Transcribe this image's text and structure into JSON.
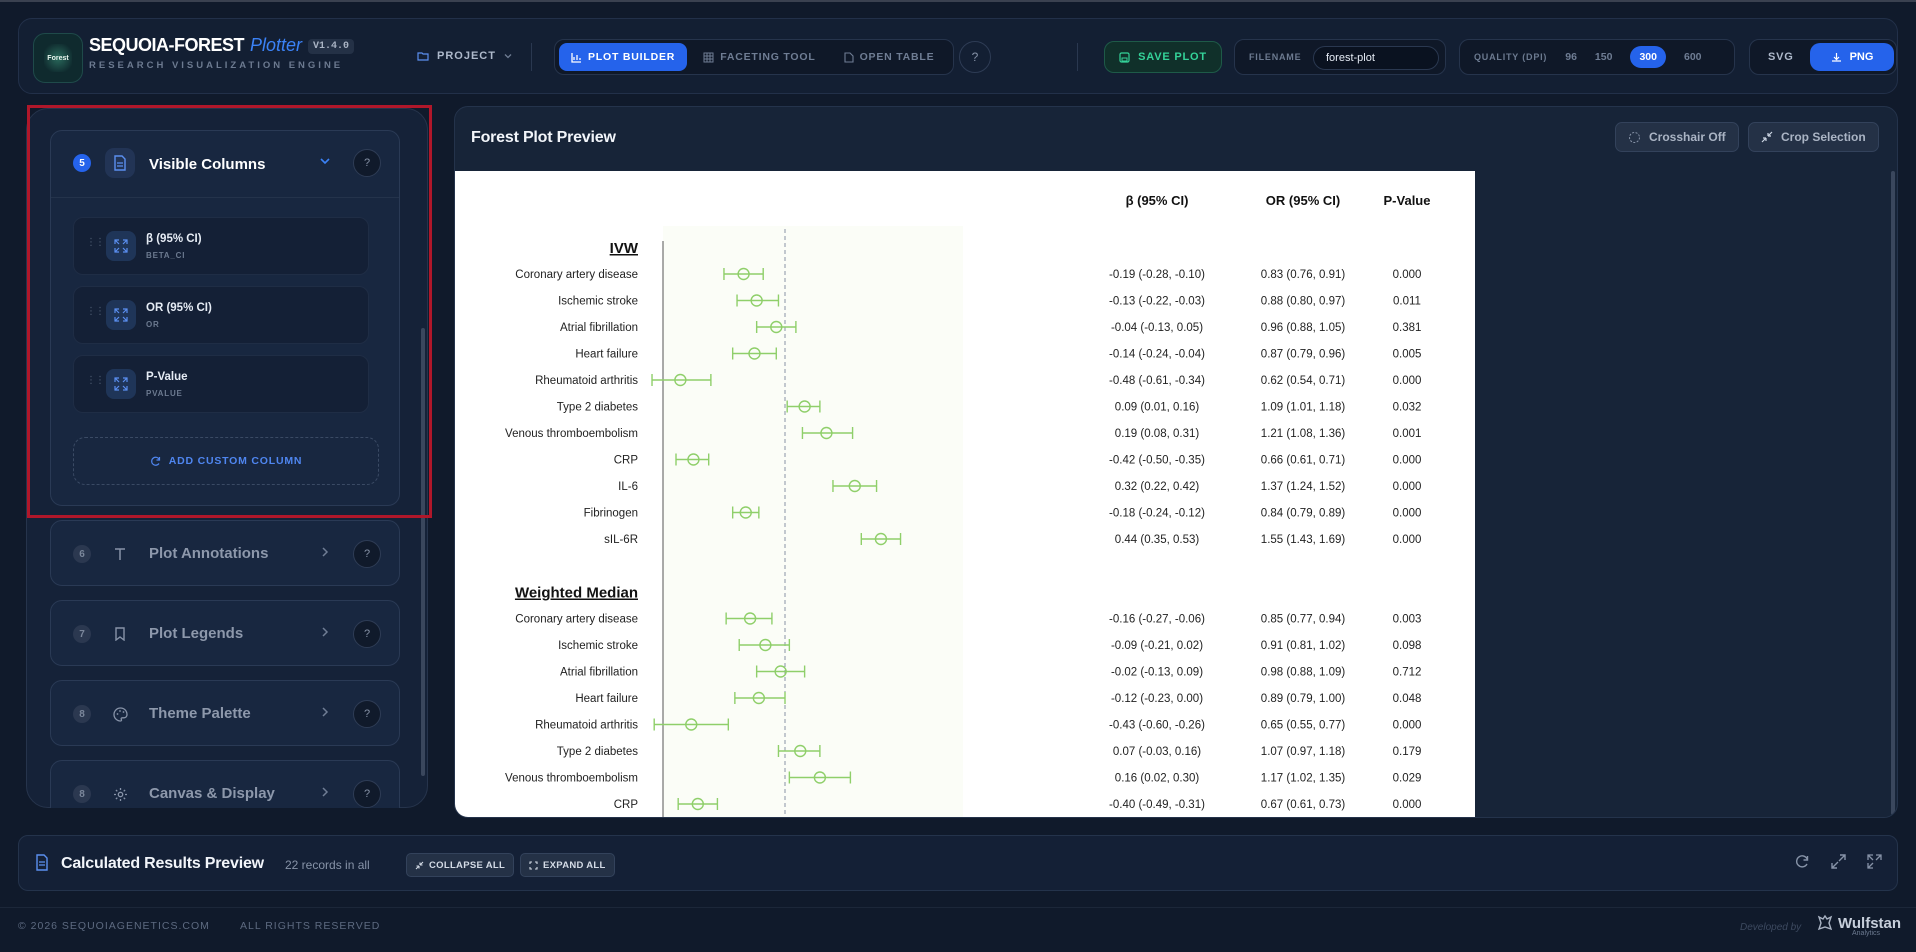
{
  "app": {
    "logo_text": "Forest",
    "brand_main": "SEQUOIA-FOREST",
    "brand_accent": "Plotter",
    "version": "V1.4.0",
    "tagline": "RESEARCH VISUALIZATION ENGINE"
  },
  "header": {
    "project_label": "PROJECT",
    "tabs": [
      {
        "label": "PLOT BUILDER",
        "icon": "bar-chart-icon",
        "active": true
      },
      {
        "label": "FACETING TOOL",
        "icon": "grid-icon",
        "active": false
      },
      {
        "label": "OPEN TABLE",
        "icon": "document-icon",
        "active": false
      }
    ],
    "help_symbol": "?",
    "save_label": "SAVE PLOT",
    "filename_label": "FILENAME",
    "filename_value": "forest-plot",
    "quality_label": "QUALITY (DPI)",
    "dpi_options": [
      "96",
      "150",
      "300",
      "600"
    ],
    "dpi_selected": "300",
    "export_svg": "SVG",
    "export_png": "PNG"
  },
  "sidebar": {
    "open_section": {
      "number": "5",
      "title": "Visible Columns",
      "icon": "document-icon",
      "columns": [
        {
          "name": "β (95% CI)",
          "key": "BETA_CI"
        },
        {
          "name": "OR (95% CI)",
          "key": "OR"
        },
        {
          "name": "P-Value",
          "key": "PVALUE"
        }
      ],
      "add_label": "ADD CUSTOM COLUMN"
    },
    "sections": [
      {
        "number": "6",
        "title": "Plot Annotations",
        "icon": "text-icon"
      },
      {
        "number": "7",
        "title": "Plot Legends",
        "icon": "bookmark-icon"
      },
      {
        "number": "8",
        "title": "Theme Palette",
        "icon": "palette-icon"
      },
      {
        "number": "8",
        "title": "Canvas & Display",
        "icon": "gear-icon"
      }
    ]
  },
  "main": {
    "title": "Forest Plot Preview",
    "crosshair_label": "Crosshair Off",
    "crop_label": "Crop Selection"
  },
  "chart_data": {
    "type": "forest",
    "null_line": 0,
    "marker_color": "#8fcf6a",
    "columns": [
      "β (95% CI)",
      "OR (95% CI)",
      "P-Value"
    ],
    "groups": [
      {
        "name": "IVW",
        "rows": [
          {
            "label": "Coronary artery disease",
            "beta": -0.19,
            "lo": -0.28,
            "hi": -0.1,
            "beta_ci": "-0.19 (-0.28, -0.10)",
            "or_ci": "0.83 (0.76, 0.91)",
            "p": "0.000"
          },
          {
            "label": "Ischemic stroke",
            "beta": -0.13,
            "lo": -0.22,
            "hi": -0.03,
            "beta_ci": "-0.13 (-0.22, -0.03)",
            "or_ci": "0.88 (0.80, 0.97)",
            "p": "0.011"
          },
          {
            "label": "Atrial fibrillation",
            "beta": -0.04,
            "lo": -0.13,
            "hi": 0.05,
            "beta_ci": "-0.04 (-0.13, 0.05)",
            "or_ci": "0.96 (0.88, 1.05)",
            "p": "0.381"
          },
          {
            "label": "Heart failure",
            "beta": -0.14,
            "lo": -0.24,
            "hi": -0.04,
            "beta_ci": "-0.14 (-0.24, -0.04)",
            "or_ci": "0.87 (0.79, 0.96)",
            "p": "0.005"
          },
          {
            "label": "Rheumatoid arthritis",
            "beta": -0.48,
            "lo": -0.61,
            "hi": -0.34,
            "beta_ci": "-0.48 (-0.61, -0.34)",
            "or_ci": "0.62 (0.54, 0.71)",
            "p": "0.000"
          },
          {
            "label": "Type 2 diabetes",
            "beta": 0.09,
            "lo": 0.01,
            "hi": 0.16,
            "beta_ci": "0.09 (0.01, 0.16)",
            "or_ci": "1.09 (1.01, 1.18)",
            "p": "0.032"
          },
          {
            "label": "Venous thromboembolism",
            "beta": 0.19,
            "lo": 0.08,
            "hi": 0.31,
            "beta_ci": "0.19 (0.08, 0.31)",
            "or_ci": "1.21 (1.08, 1.36)",
            "p": "0.001"
          },
          {
            "label": "CRP",
            "beta": -0.42,
            "lo": -0.5,
            "hi": -0.35,
            "beta_ci": "-0.42 (-0.50, -0.35)",
            "or_ci": "0.66 (0.61, 0.71)",
            "p": "0.000"
          },
          {
            "label": "IL-6",
            "beta": 0.32,
            "lo": 0.22,
            "hi": 0.42,
            "beta_ci": "0.32 (0.22, 0.42)",
            "or_ci": "1.37 (1.24, 1.52)",
            "p": "0.000"
          },
          {
            "label": "Fibrinogen",
            "beta": -0.18,
            "lo": -0.24,
            "hi": -0.12,
            "beta_ci": "-0.18 (-0.24, -0.12)",
            "or_ci": "0.84 (0.79, 0.89)",
            "p": "0.000"
          },
          {
            "label": "sIL-6R",
            "beta": 0.44,
            "lo": 0.35,
            "hi": 0.53,
            "beta_ci": "0.44 (0.35, 0.53)",
            "or_ci": "1.55 (1.43, 1.69)",
            "p": "0.000"
          }
        ]
      },
      {
        "name": "Weighted Median",
        "rows": [
          {
            "label": "Coronary artery disease",
            "beta": -0.16,
            "lo": -0.27,
            "hi": -0.06,
            "beta_ci": "-0.16 (-0.27, -0.06)",
            "or_ci": "0.85 (0.77, 0.94)",
            "p": "0.003"
          },
          {
            "label": "Ischemic stroke",
            "beta": -0.09,
            "lo": -0.21,
            "hi": 0.02,
            "beta_ci": "-0.09 (-0.21, 0.02)",
            "or_ci": "0.91 (0.81, 1.02)",
            "p": "0.098"
          },
          {
            "label": "Atrial fibrillation",
            "beta": -0.02,
            "lo": -0.13,
            "hi": 0.09,
            "beta_ci": "-0.02 (-0.13, 0.09)",
            "or_ci": "0.98 (0.88, 1.09)",
            "p": "0.712"
          },
          {
            "label": "Heart failure",
            "beta": -0.12,
            "lo": -0.23,
            "hi": 0.0,
            "beta_ci": "-0.12 (-0.23, 0.00)",
            "or_ci": "0.89 (0.79, 1.00)",
            "p": "0.048"
          },
          {
            "label": "Rheumatoid arthritis",
            "beta": -0.43,
            "lo": -0.6,
            "hi": -0.26,
            "beta_ci": "-0.43 (-0.60, -0.26)",
            "or_ci": "0.65 (0.55, 0.77)",
            "p": "0.000"
          },
          {
            "label": "Type 2 diabetes",
            "beta": 0.07,
            "lo": -0.03,
            "hi": 0.16,
            "beta_ci": "0.07 (-0.03, 0.16)",
            "or_ci": "1.07 (0.97, 1.18)",
            "p": "0.179"
          },
          {
            "label": "Venous thromboembolism",
            "beta": 0.16,
            "lo": 0.02,
            "hi": 0.3,
            "beta_ci": "0.16 (0.02, 0.30)",
            "or_ci": "1.17 (1.02, 1.35)",
            "p": "0.029"
          },
          {
            "label": "CRP",
            "beta": -0.4,
            "lo": -0.49,
            "hi": -0.31,
            "beta_ci": "-0.40 (-0.49, -0.31)",
            "or_ci": "0.67 (0.61, 0.73)",
            "p": "0.000"
          }
        ]
      }
    ]
  },
  "results": {
    "title": "Calculated Results Preview",
    "count": "22 records in all",
    "collapse_label": "COLLAPSE ALL",
    "expand_label": "EXPAND ALL"
  },
  "footer": {
    "copyright": "© 2026 SEQUOIAGENETICS.COM",
    "rights": "ALL RIGHTS RESERVED",
    "developed_by": "Developed by",
    "company": "Wulfstan",
    "company_sub": "Analytics"
  }
}
